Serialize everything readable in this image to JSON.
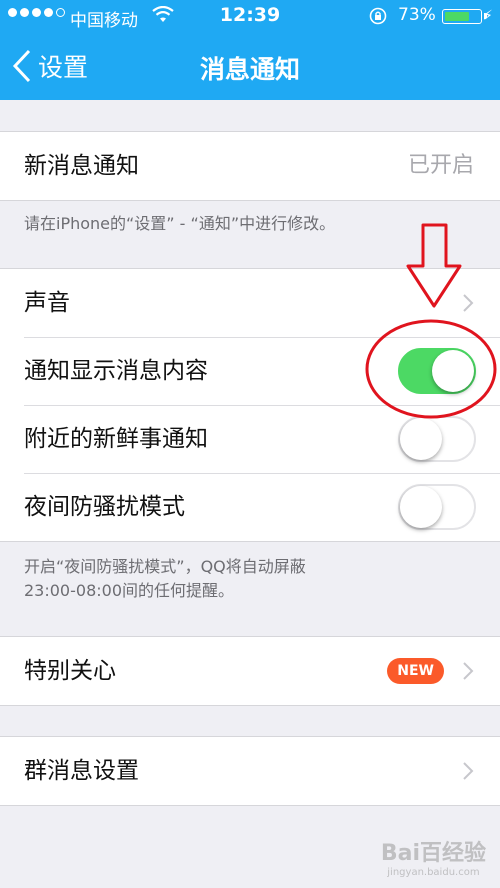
{
  "status_bar": {
    "carrier": "中国移动",
    "time": "12:39",
    "battery_percent": "73%",
    "battery_level": 0.73,
    "signal_bars_filled": 4,
    "signal_bars_total": 5
  },
  "nav": {
    "back_label": "设置",
    "title": "消息通知"
  },
  "sections": {
    "new_message": {
      "label": "新消息通知",
      "value": "已开启",
      "note": "请在iPhone的“设置” - “通知”中进行修改。"
    },
    "sound": {
      "label": "声音"
    },
    "show_content": {
      "label": "通知显示消息内容",
      "on": true
    },
    "nearby": {
      "label": "附近的新鲜事通知",
      "on": false
    },
    "night_mode": {
      "label": "夜间防骚扰模式",
      "on": false,
      "note_line1": "开启“夜间防骚扰模式”，QQ将自动屏蔽",
      "note_line2": "23:00-08:00间的任何提醒。"
    },
    "special_care": {
      "label": "特别关心",
      "badge": "NEW"
    },
    "group_settings": {
      "label": "群消息设置"
    }
  },
  "watermark": {
    "text": "Bai百经验",
    "sub": "jingyan.baidu.com"
  },
  "colors": {
    "nav_blue": "#1fa9f3",
    "toggle_on": "#4cd964",
    "badge": "#fb5a2a",
    "annotation_red": "#e0141e"
  }
}
